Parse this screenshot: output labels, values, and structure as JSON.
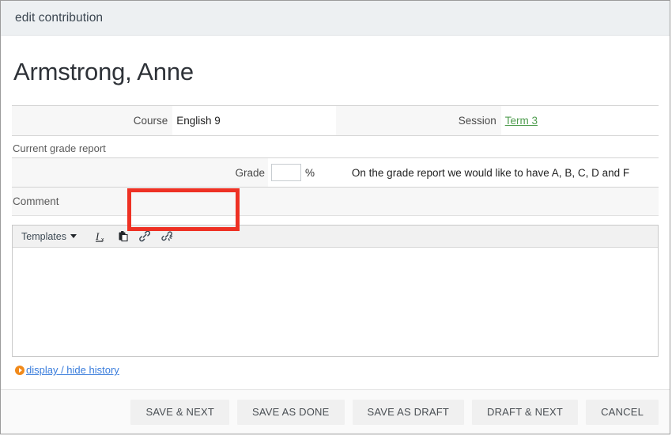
{
  "window": {
    "header_title": "edit contribution"
  },
  "student": {
    "name": "Armstrong, Anne"
  },
  "info": {
    "course_label": "Course",
    "course_value": "English 9",
    "session_label": "Session",
    "session_value": "Term 3"
  },
  "grade_report": {
    "section_caption": "Current grade report",
    "grade_label": "Grade",
    "grade_value": "",
    "grade_placeholder": "",
    "percent_symbol": "%",
    "note": "On the grade report we would like to have A, B, C, D and F",
    "highlight_color": "#ee3124"
  },
  "comment": {
    "band_label": "Comment",
    "toolbar": {
      "templates_label": "Templates",
      "icons": [
        "remove-format-icon",
        "paste-icon",
        "link-icon",
        "unlink-icon"
      ]
    },
    "body_text": ""
  },
  "history": {
    "link_label": "display / hide history",
    "bullet_color": "#f18a1b",
    "link_color": "#3a7ddc"
  },
  "footer": {
    "buttons": [
      {
        "label": "SAVE & NEXT",
        "name": "save-and-next-button"
      },
      {
        "label": "SAVE AS DONE",
        "name": "save-as-done-button"
      },
      {
        "label": "SAVE AS DRAFT",
        "name": "save-as-draft-button"
      },
      {
        "label": "DRAFT & NEXT",
        "name": "draft-and-next-button"
      },
      {
        "label": "CANCEL",
        "name": "cancel-button"
      }
    ]
  }
}
